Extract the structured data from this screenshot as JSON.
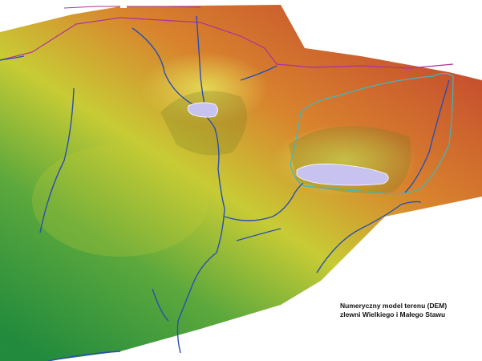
{
  "map": {
    "caption_line1": "Numeryczny model terenu (DEM)",
    "caption_line2": "zlewni Wielkiego i Małego Stawu",
    "colors": {
      "high": "#c0392b",
      "mid_high": "#d9822b",
      "mid": "#c8cc32",
      "low": "#5aa83a",
      "lowest": "#1f8a3a",
      "stream": "#2a4fb0",
      "catchment_boundary": "#b0309a",
      "lake_boundary": "#3fb7c0",
      "lake": "#c7c2f0",
      "background": "#ffffff"
    },
    "features": [
      "terrain-surface",
      "stream-network",
      "catchment-boundary",
      "lake-wielki-staw",
      "lake-maly-staw"
    ]
  }
}
